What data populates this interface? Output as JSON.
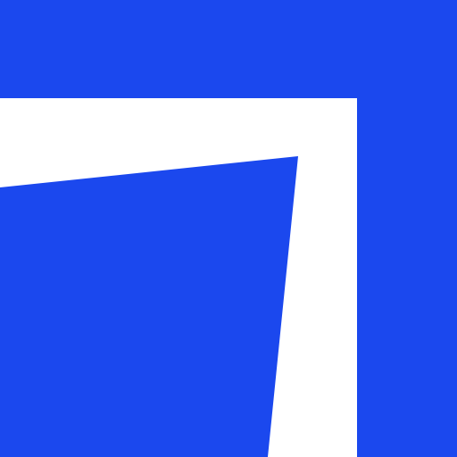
{
  "icon": {
    "name": "brand-logo-icon",
    "colors": {
      "primary": "#1B48EE",
      "secondary": "#FFFFFF"
    }
  }
}
